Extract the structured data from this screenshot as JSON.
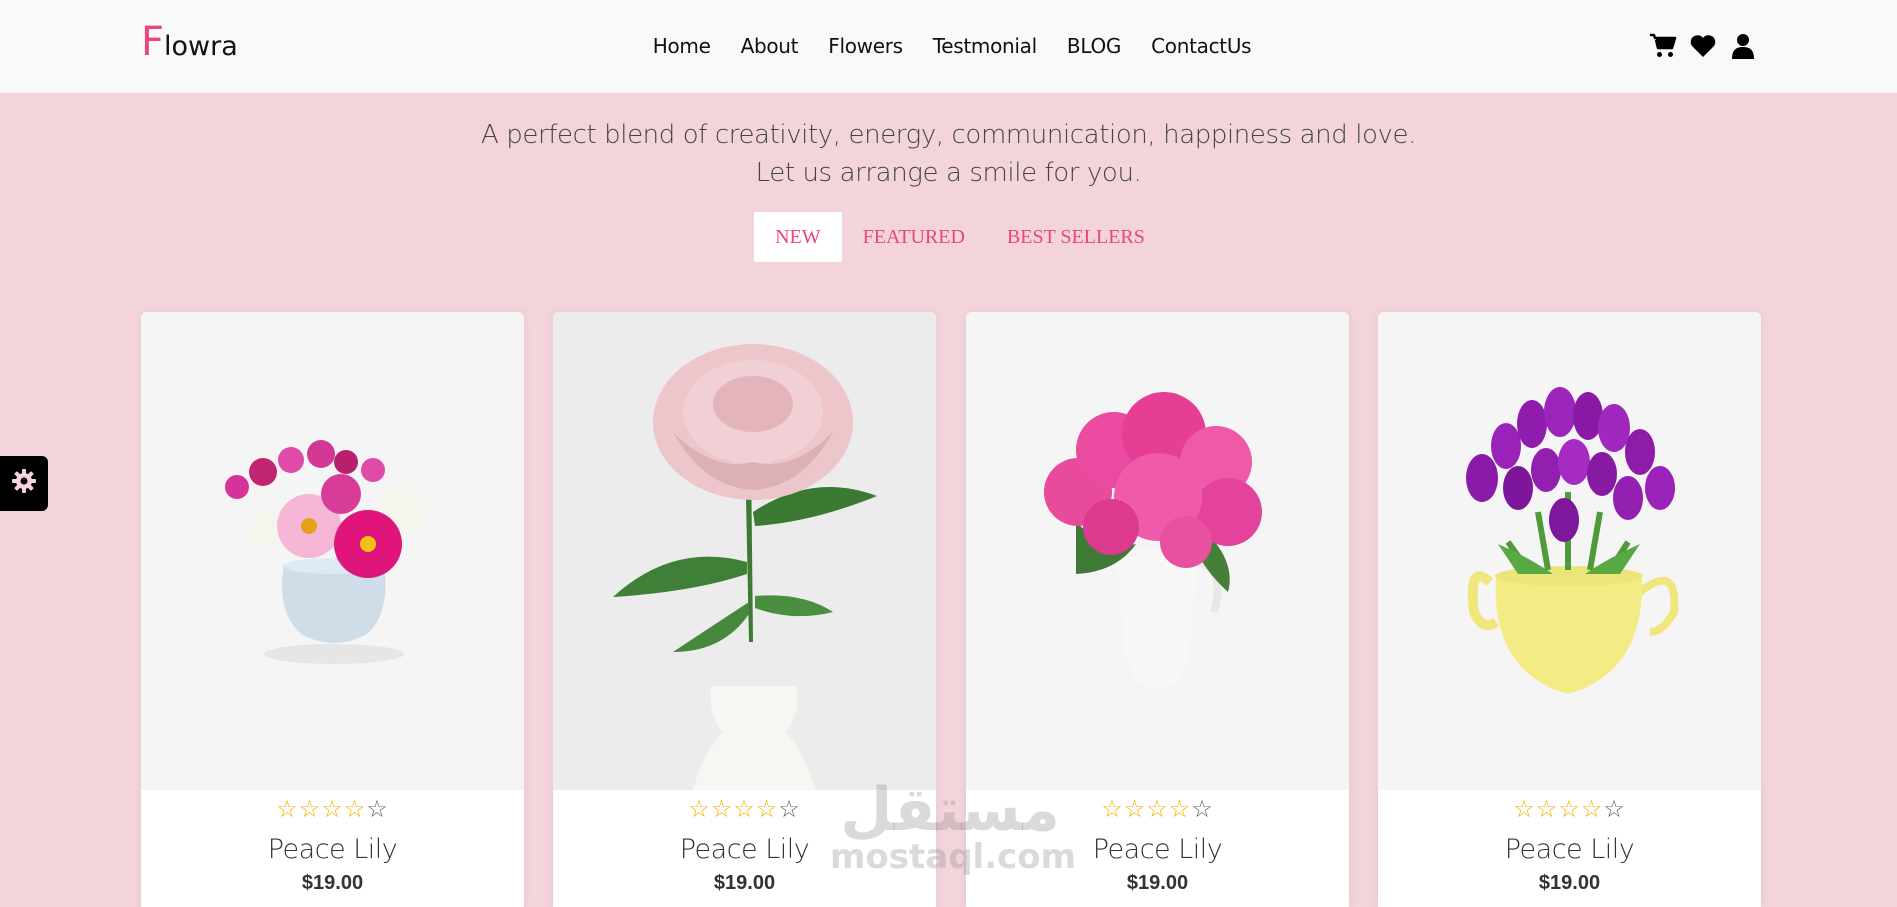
{
  "brand": {
    "first_letter": "F",
    "rest": "lowra",
    "accent_color": "#e8467c"
  },
  "nav": {
    "items": [
      {
        "label": "Home"
      },
      {
        "label": "About"
      },
      {
        "label": "Flowers"
      },
      {
        "label": "Testmonial"
      },
      {
        "label": "BLOG"
      },
      {
        "label": "ContactUs"
      }
    ]
  },
  "header_icons": [
    "cart-icon",
    "heart-icon",
    "user-icon"
  ],
  "intro": {
    "line1": "A perfect blend of creativity, energy, communication, happiness and love.",
    "line2": "Let us arrange a smile for you."
  },
  "tabs": [
    {
      "label": "NEW",
      "active": true
    },
    {
      "label": "FEATURED",
      "active": false
    },
    {
      "label": "BEST SELLERS",
      "active": false
    }
  ],
  "products": [
    {
      "name": "Peace Lily",
      "price": "$19.00",
      "rating": 4,
      "max_rating": 5,
      "image": "mixed-flowers-round-vase"
    },
    {
      "name": "Peace Lily",
      "price": "$19.00",
      "rating": 4,
      "max_rating": 5,
      "image": "pink-rose-white-vase"
    },
    {
      "name": "Peace Lily",
      "price": "$19.00",
      "rating": 4,
      "max_rating": 5,
      "image": "pink-peonies-white-pitcher"
    },
    {
      "name": "Peace Lily",
      "price": "$19.00",
      "rating": 4,
      "max_rating": 5,
      "image": "purple-tulips-yellow-teapot"
    }
  ],
  "settings_icon": "gear-icon",
  "watermark": {
    "arabic": "مستقل",
    "latin": "mostaql.com"
  }
}
